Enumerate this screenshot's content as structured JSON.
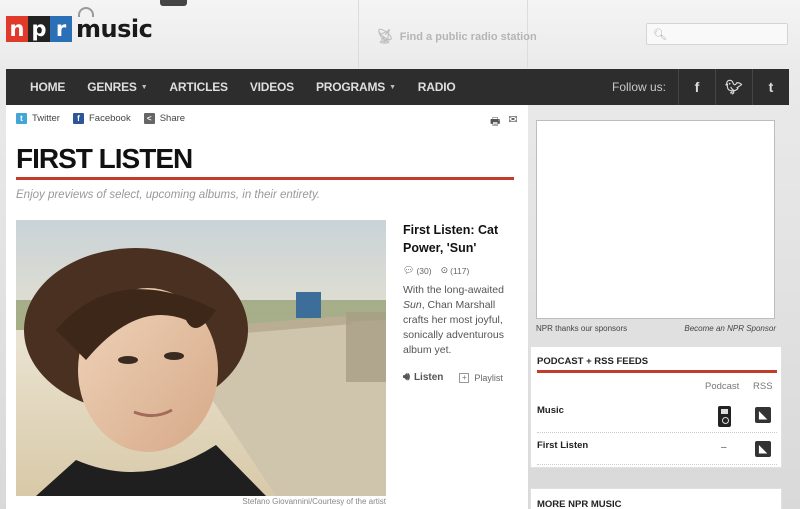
{
  "brand": {
    "npr_letters": [
      "n",
      "p",
      "r"
    ],
    "music_word": "music"
  },
  "header": {
    "find_station": "Find a public radio station",
    "search_placeholder": ""
  },
  "nav": {
    "items": [
      {
        "label": "HOME",
        "has_dropdown": false
      },
      {
        "label": "GENRES",
        "has_dropdown": true
      },
      {
        "label": "ARTICLES",
        "has_dropdown": false
      },
      {
        "label": "VIDEOS",
        "has_dropdown": false
      },
      {
        "label": "PROGRAMS",
        "has_dropdown": true
      },
      {
        "label": "RADIO",
        "has_dropdown": false
      }
    ],
    "follow_label": "Follow us:",
    "social_icons": [
      "facebook-icon",
      "twitter-icon",
      "tumblr-icon"
    ]
  },
  "share": {
    "twitter": "Twitter",
    "facebook": "Facebook",
    "share": "Share"
  },
  "page": {
    "title": "FIRST LISTEN",
    "subtitle": "Enjoy previews of select, upcoming albums, in their entirety."
  },
  "feature": {
    "photo_credit": "Stefano Giovannini/Courtesy of the artist",
    "title": "First Listen: Cat Power, 'Sun'",
    "comments_count": "(30)",
    "recommend_count": "(117)",
    "teaser_before": "With the long-awaited ",
    "teaser_italic": "Sun",
    "teaser_after": ", Chan Marshall crafts her most joyful, sonically adventurous album yet.",
    "listen_label": "Listen",
    "playlist_label": "Playlist"
  },
  "sidebar": {
    "ad_thanks": "NPR thanks our sponsors",
    "ad_sponsor": "Become an NPR Sponsor",
    "podcast_title": "PODCAST + RSS FEEDS",
    "col_podcast": "Podcast",
    "col_rss": "RSS",
    "feeds": [
      {
        "name": "Music",
        "podcast": "ipod-icon",
        "rss": "rss-icon"
      },
      {
        "name": "First Listen",
        "podcast": "–",
        "rss": "rss-icon"
      }
    ],
    "more_title": "MORE NPR MUSIC"
  },
  "colors": {
    "accent_red": "#c23b2b",
    "nav_bg": "#2d2d2d",
    "npr_red": "#e03b2a",
    "npr_blue": "#2b6fb6"
  }
}
